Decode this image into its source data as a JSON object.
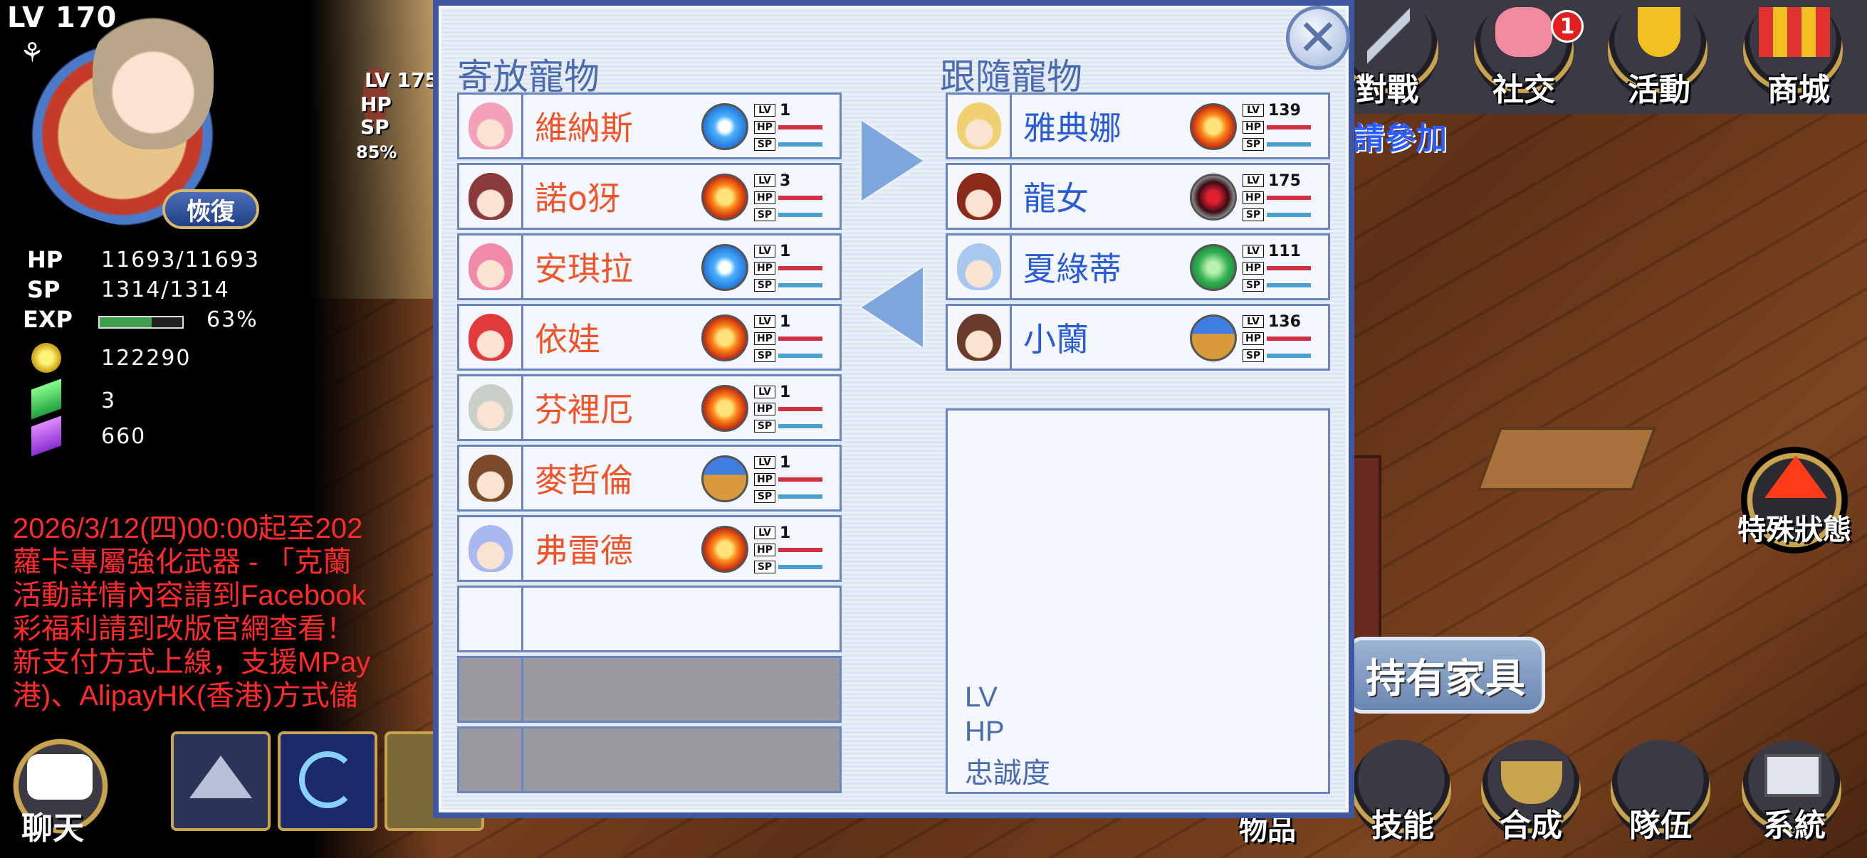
{
  "player": {
    "level_label": "LV",
    "level": "170",
    "recover_label": "恢復",
    "hp_label": "HP",
    "hp_value": "11693/11693",
    "sp_label": "SP",
    "sp_value": "1314/1314",
    "exp_label": "EXP",
    "exp_percent": "63%",
    "exp_fraction": 0.63,
    "gold": "122290",
    "green_gems": "3",
    "purple_gems": "660"
  },
  "party_member": {
    "lv_label": "LV",
    "level": "175",
    "hp_label": "HP",
    "sp_label": "SP",
    "percent": "85%"
  },
  "announcement": [
    "2026/3/12(四)00:00起至202",
    "蘿卡專屬強化武器 - 「克蘭",
    "活動詳情內容請到Facebook",
    "彩福利請到改版官網查看！",
    "新支付方式上線，支援MPay",
    "港)、AlipayHK(香港)方式儲"
  ],
  "top_menu": [
    {
      "label": "對戰"
    },
    {
      "label": "社交",
      "badge": "1"
    },
    {
      "label": "活動"
    },
    {
      "label": "商城"
    }
  ],
  "join_text": "請參加",
  "special_status_label": "特殊狀態",
  "furniture_label": "持有家具",
  "bottom_menu": [
    {
      "label": "物品"
    },
    {
      "label": "技能"
    },
    {
      "label": "合成"
    },
    {
      "label": "隊伍"
    },
    {
      "label": "系統"
    }
  ],
  "chat_label": "聊天",
  "dialog": {
    "close_symbol": "✕",
    "stored_title": "寄放寵物",
    "follow_title": "跟隨寵物",
    "stored_pets": [
      {
        "name": "維納斯",
        "level": "1",
        "element": "ice",
        "face": "#f3a0b8"
      },
      {
        "name": "諾o犽",
        "level": "3",
        "element": "fire",
        "face": "#8a3a3a"
      },
      {
        "name": "安琪拉",
        "level": "1",
        "element": "ice",
        "face": "#f08aa8"
      },
      {
        "name": "依娃",
        "level": "1",
        "element": "fire",
        "face": "#e03a3a"
      },
      {
        "name": "芬裡厄",
        "level": "1",
        "element": "fire",
        "face": "#c8d0c8"
      },
      {
        "name": "麥哲倫",
        "level": "1",
        "element": "earth",
        "face": "#7a4a2a"
      },
      {
        "name": "弗雷德",
        "level": "1",
        "element": "fire",
        "face": "#a8b8f0"
      }
    ],
    "follow_pets": [
      {
        "name": "雅典娜",
        "level": "139",
        "element": "fire",
        "face": "#f0d070"
      },
      {
        "name": "龍女",
        "level": "175",
        "element": "dark",
        "face": "#8a2a1a"
      },
      {
        "name": "夏綠蒂",
        "level": "111",
        "element": "wind",
        "face": "#a8c8f0"
      },
      {
        "name": "小蘭",
        "level": "136",
        "element": "earth",
        "face": "#6a3a2a"
      }
    ],
    "bar_labels": {
      "lv": "LV",
      "hp": "HP",
      "sp": "SP"
    },
    "info_labels": {
      "lv": "LV",
      "hp": "HP",
      "loyalty": "忠誠度"
    }
  },
  "colors": {
    "dialog_border": "#3f57a0",
    "stored_name": "#f0552a",
    "follow_name": "#2a5cd6",
    "announcement": "#ff2a2a"
  }
}
